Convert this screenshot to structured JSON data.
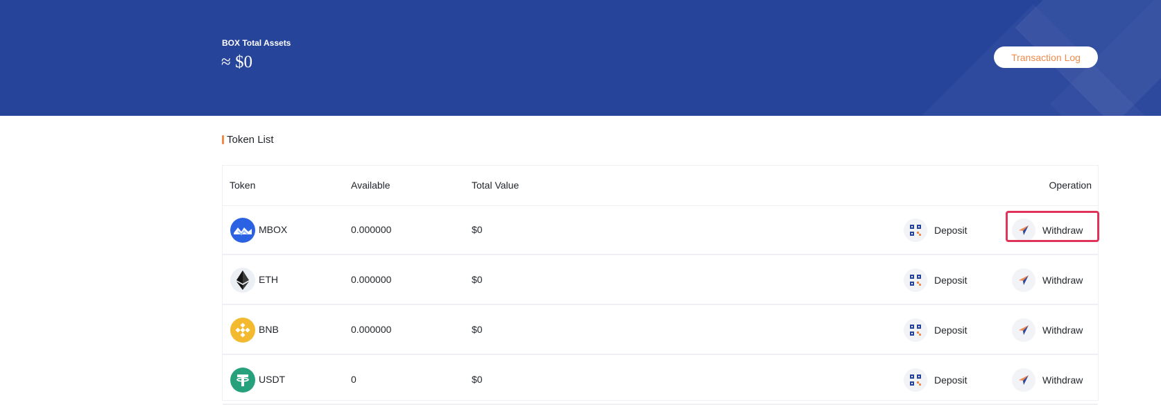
{
  "header": {
    "assets_label": "BOX Total Assets",
    "assets_value": "≈ $0",
    "transaction_log_label": "Transaction Log"
  },
  "section": {
    "title": "Token List"
  },
  "table": {
    "columns": {
      "token": "Token",
      "available": "Available",
      "total_value": "Total Value",
      "operation": "Operation"
    },
    "rows": [
      {
        "token": "MBOX",
        "available": "0.000000",
        "total_value": "$0",
        "deposit": "Deposit",
        "withdraw": "Withdraw",
        "icon": "mbox-icon",
        "icon_color": "#2b62e3"
      },
      {
        "token": "ETH",
        "available": "0.000000",
        "total_value": "$0",
        "deposit": "Deposit",
        "withdraw": "Withdraw",
        "icon": "eth-icon",
        "icon_color": "#eceff3"
      },
      {
        "token": "BNB",
        "available": "0.000000",
        "total_value": "$0",
        "deposit": "Deposit",
        "withdraw": "Withdraw",
        "icon": "bnb-icon",
        "icon_color": "#f3ba2f"
      },
      {
        "token": "USDT",
        "available": "0",
        "total_value": "$0",
        "deposit": "Deposit",
        "withdraw": "Withdraw",
        "icon": "usdt-icon",
        "icon_color": "#26a17b"
      }
    ]
  },
  "colors": {
    "banner": "#27449b",
    "accent": "#f08a4b",
    "highlight": "#e0335a"
  }
}
